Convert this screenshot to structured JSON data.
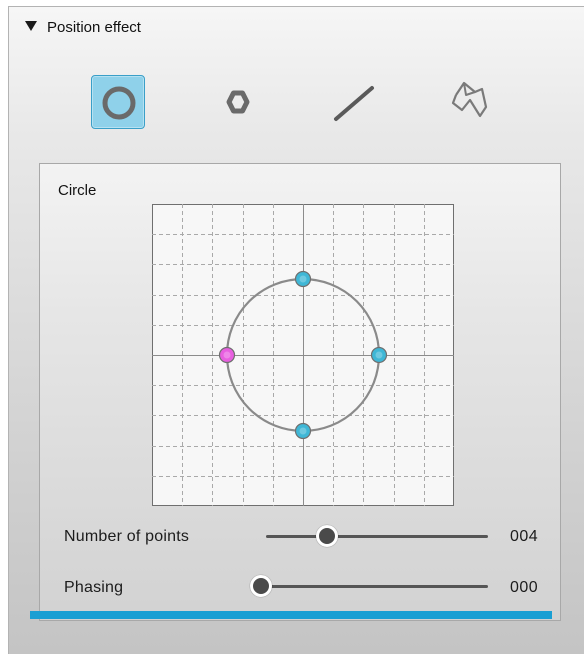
{
  "panel": {
    "title": "Position effect"
  },
  "toolbar": {
    "items": [
      {
        "icon": "circle-icon",
        "selected": true
      },
      {
        "icon": "hexagon-icon",
        "selected": false
      },
      {
        "icon": "line-icon",
        "selected": false
      },
      {
        "icon": "freeform-polygon-icon",
        "selected": false
      }
    ]
  },
  "shape": {
    "title": "Circle",
    "points": [
      {
        "angle_deg": 90,
        "color": "#3fb7d6",
        "selected": false
      },
      {
        "angle_deg": 0,
        "color": "#3fb7d6",
        "selected": false
      },
      {
        "angle_deg": 270,
        "color": "#3fb7d6",
        "selected": false
      },
      {
        "angle_deg": 180,
        "color": "#e85fe0",
        "selected": true
      }
    ]
  },
  "controls": {
    "number_of_points": {
      "label": "Number of points",
      "value": "004",
      "fraction": 0.25
    },
    "phasing": {
      "label": "Phasing",
      "value": "000",
      "fraction": 0.0
    }
  },
  "colors": {
    "accent": "#1a9fd3",
    "selected_tool": "#8fd1ea",
    "point": "#3fb7d6",
    "start_point": "#e85fe0"
  }
}
